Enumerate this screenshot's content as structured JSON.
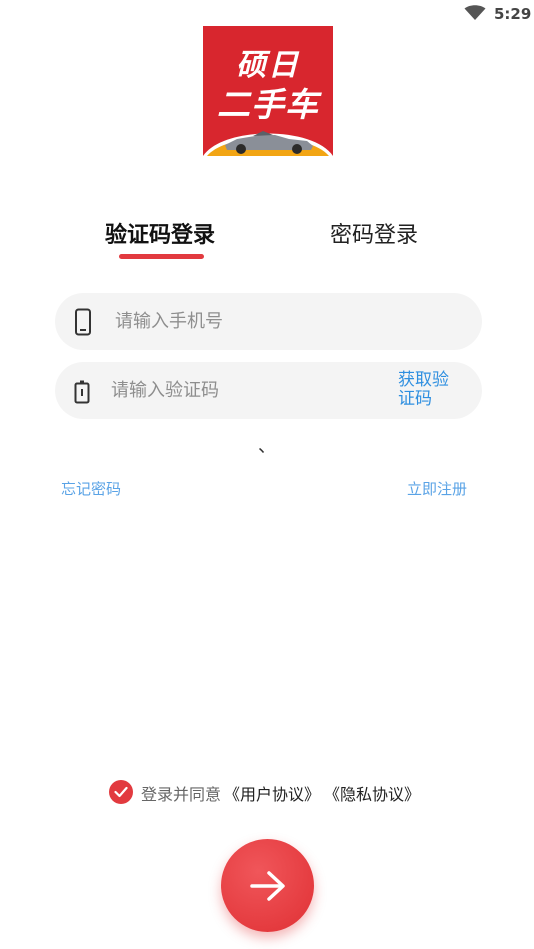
{
  "status_bar": {
    "time": "5:29",
    "wifi_icon": "wifi-icon"
  },
  "logo": {
    "line1": "硕日",
    "line2": "二手车",
    "colors": {
      "background": "#d8262e",
      "arc": "#f2a514"
    }
  },
  "tabs": [
    {
      "label": "验证码登录",
      "active": true
    },
    {
      "label": "密码登录",
      "active": false
    }
  ],
  "phone_field": {
    "placeholder": "请输入手机号",
    "value": "",
    "icon": "phone-icon"
  },
  "code_field": {
    "placeholder": "请输入验证码",
    "value": "",
    "icon": "battery-icon",
    "get_code_label": "获取验证码"
  },
  "stray_mark": "、",
  "links": {
    "forgot": "忘记密码",
    "register": "立即注册"
  },
  "agreement": {
    "checked": true,
    "prefix": "登录并同意",
    "user_agreement": "《用户协议》",
    "privacy_agreement": "《隐私协议》"
  },
  "submit": {
    "icon": "arrow-right-icon"
  },
  "colors": {
    "accent": "#e23a3f",
    "link": "#5aa3e6",
    "field_bg": "#f4f4f4"
  }
}
